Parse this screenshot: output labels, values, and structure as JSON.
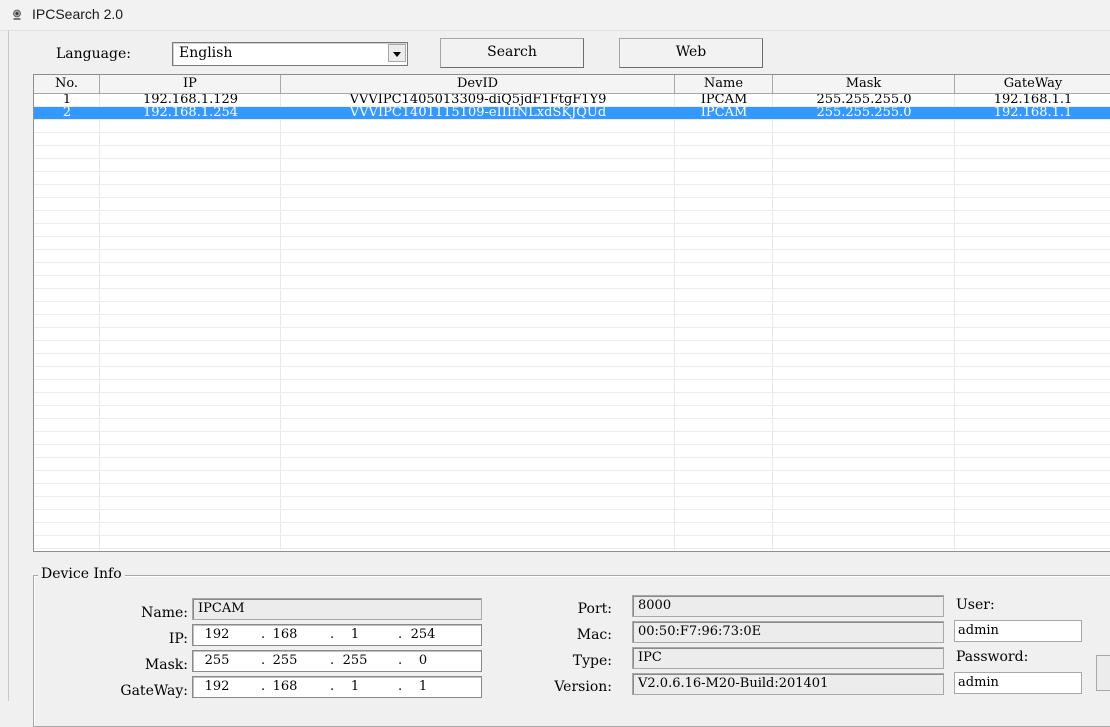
{
  "window": {
    "title": "IPCSearch 2.0",
    "icon": "ipcam-icon"
  },
  "toolbar": {
    "language_label": "Language:",
    "language_value": "English",
    "search_label": "Search",
    "web_label": "Web"
  },
  "table": {
    "columns": [
      "No.",
      "IP",
      "DevID",
      "Name",
      "Mask",
      "GateWay"
    ],
    "rows": [
      [
        "1",
        "192.168.1.129",
        "VVVIPC1405013309-diQ5jdF1FtgF1Y9",
        "IPCAM",
        "255.255.255.0",
        "192.168.1.1"
      ],
      [
        "2",
        "192.168.1.254",
        "VVVIPC1401115109-eIIIfNLxdSKJQUd",
        "IPCAM",
        "255.255.255.0",
        "192.168.1.1"
      ]
    ],
    "selected_row": 2
  },
  "device_info": {
    "title": "Device Info",
    "name_label": "Name:",
    "name_value": "IPCAM",
    "ip_label": "IP:",
    "ip_octets": [
      "192",
      "168",
      "1",
      "254"
    ],
    "mask_label": "Mask:",
    "mask_octets": [
      "255",
      "255",
      "255",
      "0"
    ],
    "gateway_label": "GateWay:",
    "gateway_octets": [
      "192",
      "168",
      "1",
      "1"
    ],
    "port_label": "Port:",
    "port_value": "8000",
    "mac_label": "Mac:",
    "mac_value": "00:50:F7:96:73:0E",
    "type_label": "Type:",
    "type_value": "IPC",
    "version_label": "Version:",
    "version_value": "V2.0.6.16-M20-Build:201401",
    "user_label": "User:",
    "user_value": "admin",
    "password_label": "Password:",
    "password_value": "admin"
  },
  "colors": {
    "selection": "#3399ff",
    "selection_text": "#ffffff"
  }
}
